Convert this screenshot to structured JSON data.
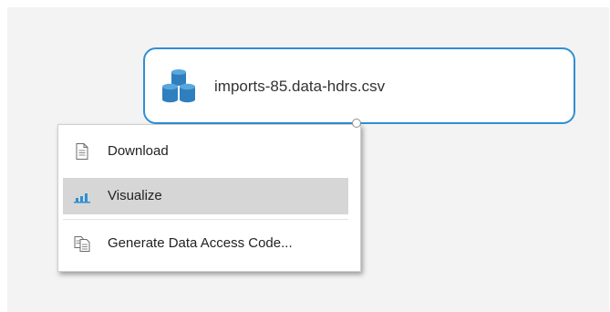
{
  "node": {
    "label": "imports-85.data-hdrs.csv",
    "icon": "database-cylinders-icon",
    "border_color": "#2f8fd2"
  },
  "context_menu": {
    "items": [
      {
        "label": "Download",
        "icon": "document-icon",
        "hovered": false
      },
      {
        "label": "Visualize",
        "icon": "bar-chart-icon",
        "hovered": true
      },
      {
        "label": "Generate Data Access Code...",
        "icon": "copy-document-icon",
        "hovered": false
      }
    ]
  }
}
